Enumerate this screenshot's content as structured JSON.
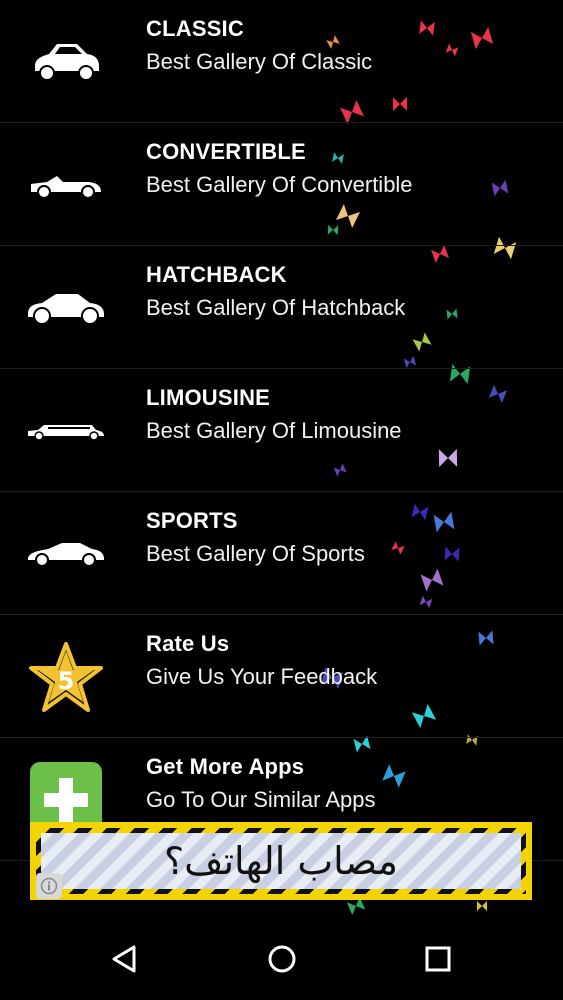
{
  "menu": {
    "items": [
      {
        "icon": "classic-car-icon",
        "title": "CLASSIC",
        "subtitle": "Best Gallery Of Classic"
      },
      {
        "icon": "convertible-car-icon",
        "title": "CONVERTIBLE",
        "subtitle": "Best Gallery Of Convertible"
      },
      {
        "icon": "hatchback-car-icon",
        "title": "HATCHBACK",
        "subtitle": "Best Gallery Of Hatchback"
      },
      {
        "icon": "limousine-car-icon",
        "title": "LIMOUSINE",
        "subtitle": "Best Gallery Of Limousine"
      },
      {
        "icon": "sports-car-icon",
        "title": "SPORTS",
        "subtitle": "Best Gallery Of Sports"
      },
      {
        "icon": "star-five-icon",
        "title": "Rate Us",
        "subtitle": "Give Us Your Feedback"
      },
      {
        "icon": "green-plus-icon",
        "title": "Get More Apps",
        "subtitle": "Go To Our Similar Apps"
      }
    ]
  },
  "ad": {
    "text": "مصاب الهاتف؟",
    "info_icon": "info-icon"
  },
  "navbar": {
    "back_icon": "back-triangle-icon",
    "home_icon": "home-circle-icon",
    "recents_icon": "recents-square-icon"
  },
  "colors": {
    "background": "#000000",
    "ad_stripe": "#f4d400",
    "star": "#f2c230",
    "plus_bg": "#6cc04a"
  }
}
